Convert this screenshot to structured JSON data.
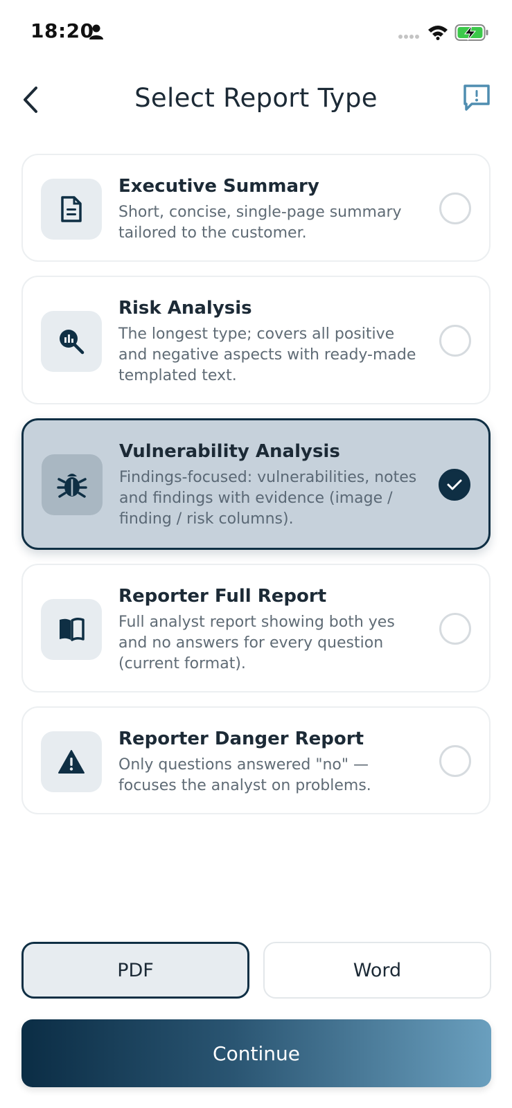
{
  "status_bar": {
    "time": "18:20"
  },
  "header": {
    "title": "Select Report Type"
  },
  "report_types": [
    {
      "title": "Executive Summary",
      "description": "Short, concise, single-page summary tailored to the customer.",
      "icon": "document-icon",
      "selected": false
    },
    {
      "title": "Risk Analysis",
      "description": "The longest type; covers all positive and negative aspects with ready-made templated text.",
      "icon": "magnifier-chart-icon",
      "selected": false
    },
    {
      "title": "Vulnerability Analysis",
      "description": "Findings-focused: vulnerabilities, notes and findings with evidence (image / finding / risk columns).",
      "icon": "bug-icon",
      "selected": true
    },
    {
      "title": "Reporter Full Report",
      "description": "Full analyst report showing both yes and no answers for every question (current format).",
      "icon": "book-icon",
      "selected": false
    },
    {
      "title": "Reporter Danger Report",
      "description": "Only questions answered \"no\" — focuses the analyst on problems.",
      "icon": "warning-icon",
      "selected": false
    }
  ],
  "format": {
    "pdf_label": "PDF",
    "word_label": "Word",
    "selected": "PDF"
  },
  "continue_label": "Continue",
  "colors": {
    "primary": "#0f2f44",
    "selected_bg": "#c6d1db",
    "icon_bg": "#e7ecf0",
    "accent_blue": "#4f8db0"
  }
}
